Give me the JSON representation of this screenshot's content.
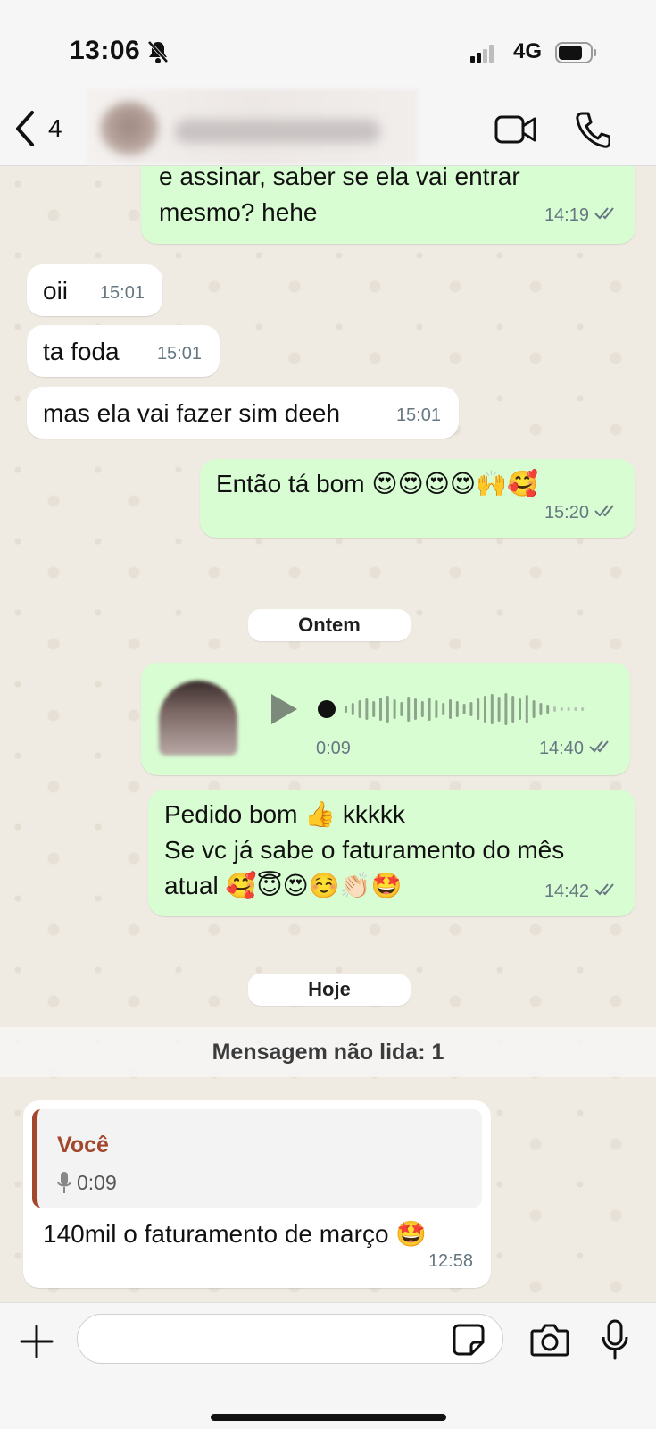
{
  "status_bar": {
    "time": "13:06",
    "network": "4G"
  },
  "header": {
    "back_count": "4"
  },
  "messages": [
    {
      "id": "m1",
      "direction": "out",
      "text": "e assinar, saber se ela vai entrar\nmesmo? hehe",
      "time": "14:19",
      "status": "read"
    },
    {
      "id": "m2",
      "direction": "in",
      "text": "oii",
      "time": "15:01"
    },
    {
      "id": "m3",
      "direction": "in",
      "text": "ta foda",
      "time": "15:01"
    },
    {
      "id": "m4",
      "direction": "in",
      "text": "mas ela vai fazer sim deeh",
      "time": "15:01"
    },
    {
      "id": "m5",
      "direction": "out",
      "text": "Então tá bom 😍😍😍😍🙌🥰",
      "time": "15:20",
      "status": "read"
    },
    {
      "id": "m6",
      "direction": "out",
      "type": "voice",
      "duration": "0:09",
      "time": "14:40",
      "status": "read"
    },
    {
      "id": "m7",
      "direction": "out",
      "text": "Pedido bom 👍 kkkkk\nSe vc já sabe o faturamento do mês\natual 🥰😇😍☺️👏🏻🤩",
      "time": "14:42",
      "status": "read"
    },
    {
      "id": "m8",
      "direction": "in",
      "quote": {
        "author": "Você",
        "audio_duration": "0:09"
      },
      "text": "140mil o faturamento de março 🤩",
      "time": "12:58"
    }
  ],
  "day_separators": {
    "yesterday": "Ontem",
    "today": "Hoje"
  },
  "unread_banner": "Mensagem não lida: 1",
  "input": {
    "placeholder": ""
  },
  "colors": {
    "outgoing": "#d9fdd3",
    "incoming": "#ffffff",
    "background": "#efeae2",
    "quote_accent": "#a2462c",
    "ticks": "#667781"
  }
}
